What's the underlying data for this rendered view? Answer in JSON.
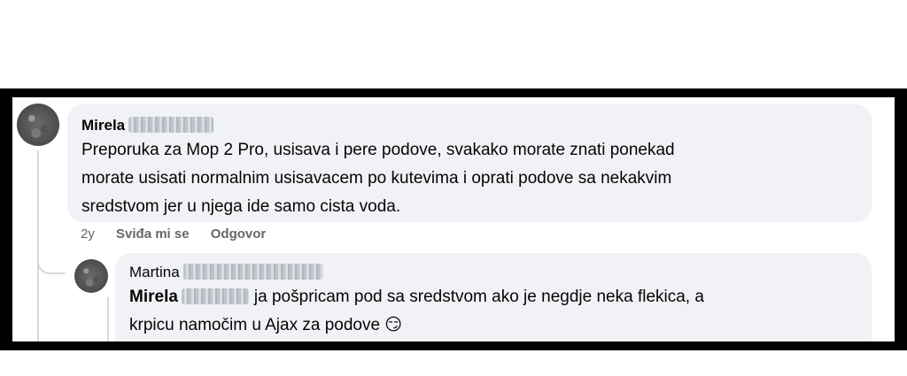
{
  "comments": [
    {
      "author": "Mirela",
      "text_lines": [
        "Preporuka za Mop 2 Pro, usisava i pere podove, svakako morate znati ponekad",
        "morate usisati normalnim usisavacem po kutevima i oprati podove sa nekakvim",
        "sredstvom jer u njega ide samo cista voda."
      ],
      "time": "2y",
      "like_label": "Sviđa mi se",
      "reply_label": "Odgovor"
    },
    {
      "author": "Martina",
      "mention": "Mirela",
      "text_line_1": "ja pošpricam pod sa sredstvom ako je negdje neka flekica, a",
      "text_line_2": "krpicu namočim u Ajax za podove 😏"
    }
  ]
}
